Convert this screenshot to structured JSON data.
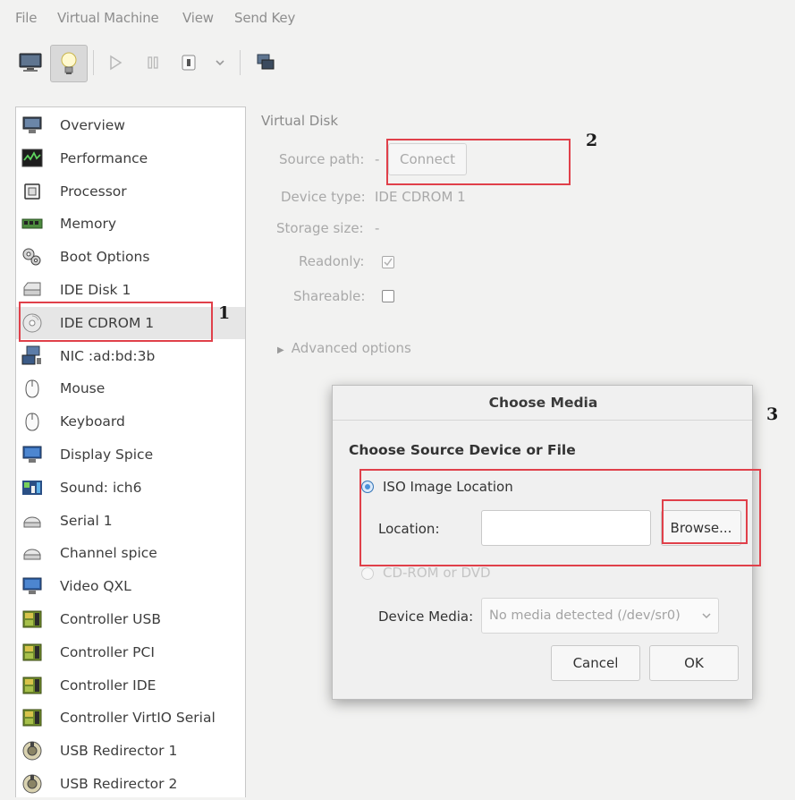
{
  "menubar": {
    "items": [
      "File",
      "Virtual Machine",
      "View",
      "Send Key"
    ]
  },
  "sidebar": {
    "selected": "IDE CDROM 1",
    "items": [
      {
        "label": "Overview",
        "icon": "monitor-icon"
      },
      {
        "label": "Performance",
        "icon": "performance-icon"
      },
      {
        "label": "Processor",
        "icon": "processor-icon"
      },
      {
        "label": "Memory",
        "icon": "memory-icon"
      },
      {
        "label": "Boot Options",
        "icon": "gears-icon"
      },
      {
        "label": "IDE Disk 1",
        "icon": "disk-icon"
      },
      {
        "label": "IDE CDROM 1",
        "icon": "cdrom-icon"
      },
      {
        "label": "NIC :ad:bd:3b",
        "icon": "network-icon"
      },
      {
        "label": "Mouse",
        "icon": "mouse-icon"
      },
      {
        "label": "Keyboard",
        "icon": "keyboard-icon"
      },
      {
        "label": "Display Spice",
        "icon": "display-icon"
      },
      {
        "label": "Sound: ich6",
        "icon": "sound-icon"
      },
      {
        "label": "Serial 1",
        "icon": "serial-icon"
      },
      {
        "label": "Channel spice",
        "icon": "channel-icon"
      },
      {
        "label": "Video QXL",
        "icon": "video-icon"
      },
      {
        "label": "Controller USB",
        "icon": "controller-icon"
      },
      {
        "label": "Controller PCI",
        "icon": "controller-icon"
      },
      {
        "label": "Controller IDE",
        "icon": "controller-icon"
      },
      {
        "label": "Controller VirtIO Serial",
        "icon": "controller-icon"
      },
      {
        "label": "USB Redirector 1",
        "icon": "usb-redirector-icon"
      },
      {
        "label": "USB Redirector 2",
        "icon": "usb-redirector-icon"
      }
    ]
  },
  "details": {
    "section_title": "Virtual Disk",
    "source_path_label": "Source path:",
    "source_path_value": "-",
    "connect_label": "Connect",
    "device_type_label": "Device type:",
    "device_type_value": "IDE CDROM 1",
    "storage_size_label": "Storage size:",
    "storage_size_value": "-",
    "readonly_label": "Readonly:",
    "readonly_checked": true,
    "shareable_label": "Shareable:",
    "shareable_checked": false,
    "advanced_label": "Advanced options"
  },
  "annotations": {
    "one": "1",
    "two": "2",
    "three": "3",
    "color": "#e0404a"
  },
  "dialog": {
    "title": "Choose Media",
    "heading": "Choose Source Device or File",
    "iso_option": "ISO Image Location",
    "location_label": "Location:",
    "location_value": "",
    "browse_label": "Browse...",
    "cdrom_option": "CD-ROM or DVD",
    "device_media_label": "Device Media:",
    "device_media_value": "No media detected (/dev/sr0)",
    "cancel_label": "Cancel",
    "ok_label": "OK"
  }
}
